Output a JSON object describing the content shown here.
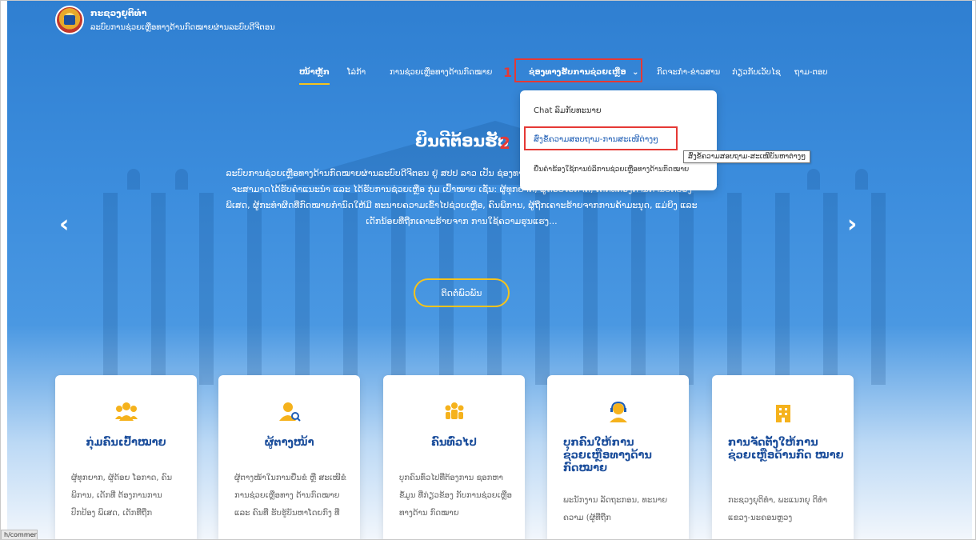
{
  "header": {
    "title": "ກະຊວງຍຸຕິທຳ",
    "subtitle": "ລະບົບການຊ່ວຍເຫຼືອທາງດ້ານກົດໝາຍຜ່ານລະບົບດີຈີຕອນ"
  },
  "nav": {
    "items": [
      {
        "label": "ໜ້າຫຼັກ"
      },
      {
        "label": "ໂລ່ກ້າ"
      },
      {
        "label": "ການຊ່ວຍເຫຼືອທາງດ້ານກົດໝາຍ"
      },
      {
        "label": "ຊ່ອງທາງຮັບການຊ່ວຍເຫຼືອ"
      },
      {
        "label": "ກິດຈະກຳ-ຂ່າວສານ"
      },
      {
        "label": "ກ່ຽວກັບເວັບໄຊ"
      },
      {
        "label": "ຖາມ-ຕອບ"
      }
    ],
    "dropdown_caret": "⌄"
  },
  "annotations": {
    "num1": "1",
    "num2": "2"
  },
  "dropdown": {
    "items": [
      {
        "label": "Chat ລົມກັບທະນາຍ"
      },
      {
        "label": "ສົ່ງຂໍ້ຄວາມສອບຖາມ-ການສະເໜີຕ່າງໆ"
      },
      {
        "label": "ຍື່ນຄຳຮ້ອງໃຊ້ການບໍລິການຊ່ວຍເຫຼືອທາງດ້ານກົດໝາຍ"
      }
    ],
    "tooltip": "ສົ່ງຂໍ້ຄວາມສອບຖາມ-ສະເໜີບັນຫາຕ່າງໆ"
  },
  "hero": {
    "title": "ຍິນດີຕ້ອນຮັບ",
    "description": "ລະບົບການຊ່ວຍເຫຼືອທາງດ້ານກົດໝາຍຜ່ານລະບົບດີຈີຕອນ ຢູ່ ສປປ ລາວ ເປັນ ຊ່ອງທາງການໃຫ້ບໍລິການ ດ້ານກົດໝາຍຢູ່ ສປປ ລາວ, ຜູ້ທີ່ຈະສາມາດໄດ້ຮັບຄຳແນະນຳ ແລະ ໄດ້ຮັບການຊ່ວຍເຫຼືອ ກຸ່ມ ເປົ້າໝາຍ ເຊັ່ນ: ຜູ້ທຸກຍາກ, ຜູ້ດ້ອຍໂອກາດ, ເດັກທີ່ຕ້ອງການການປົກປ້ອງພິເສດ, ຜູ້ກະທຳຜິດທີ່ກົດໝາຍກຳນົດໃຫ້ມີ ທະນາຍຄວາມເຂົ້າໄປຊ່ວຍເຫຼືອ, ຄົນພິການ, ຜູ້ຖືກເຄາະຮ້າຍຈາກການຄ້າມະນຸດ, ແມ່ຍິງ ແລະ ເດັກນ້ອຍທີ່ຖືກເຄາະຮ້າຍຈາກ ການໃຊ້ຄວາມຮຸນແຮງ...",
    "button": "ຕິດຕໍ່ພົວພັນ",
    "prev_arrow": "‹",
    "next_arrow": "›"
  },
  "cards": [
    {
      "icon": "group-icon",
      "title": "ກຸ່ມຄົນເປົ້າໝາຍ",
      "body": "ຜູ້ທຸກຍາກ, ຜູ້ດ້ອຍ ໂອກາດ, ຄົນພິການ, ເດັກທີ່ ຕ້ອງການການປົກປ້ອງ ພິເສດ, ເດັກທີ່ຖືກ"
    },
    {
      "icon": "user-search-icon",
      "title": "ຜູ້ຕາງໜ້າ",
      "body": "ຜູ້ຕາງໜ້າໃນການຍື່ນຂໍ ຫຼື ສະເໜີຂໍການຊ່ວຍເຫຼືອທາງ ດ້ານກົດໝາຍ ແລະ ຄົນທີ່ ຮັບຮູ້ບັນຫາໂດຍກົງ ທີ່"
    },
    {
      "icon": "people-icon",
      "title": "ຄົນທົ່ວໄປ",
      "body": "ບຸກຄົນທົ່ວໄປທີ່ຕ້ອງການ ຊອກຫາຂໍ້ມູນ ທີ່ກ່ຽວຂ້ອງ ກັບການຊ່ວຍເຫຼືອທາງດ້ານ ກົດໝາຍ"
    },
    {
      "icon": "support-agent-icon",
      "title": "ບຸກຄົນໃຫ້ການ ຊ່ວຍເຫຼືອທາງດ້ານ ກົດໝາຍ",
      "body": "ພະນັກງານ ລັດຖະກອນ, ທະນາຍ ຄວາມ (ຜູ້ທີ່ຖືກ"
    },
    {
      "icon": "building-icon",
      "title": "ການຈັດຕັ້ງໃຫ້ການ ຊ່ວຍເຫຼືອດ້ານກົດ ໝາຍ",
      "body": "ກະຊວງຍຸຕິທຳ, ພະແນກຍຸ ຕິທຳແຂວງ-ນະຄອນຫຼວງ"
    }
  ],
  "status_bar": {
    "url": "h/comment/"
  },
  "colors": {
    "accent": "#f5c31c",
    "primary": "#1d4f9c",
    "annotation": "#e53935"
  }
}
